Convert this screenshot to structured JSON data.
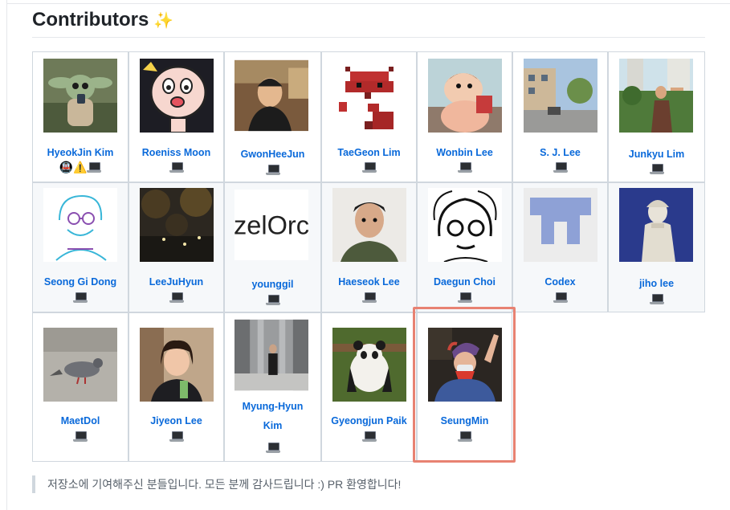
{
  "section": {
    "title": "Contributors",
    "title_icon": "sparkles-icon",
    "note": "저장소에 기여해주신 분들입니다. 모든 분께 감사드립니다 :) PR 환영합니다!"
  },
  "contributors": [
    {
      "name": "HyeokJin Kim",
      "badges": [
        "🚇",
        "⚠️"
      ],
      "laptop": true
    },
    {
      "name": "Roeniss Moon",
      "badges": [],
      "laptop": true
    },
    {
      "name": "GwonHeeJun",
      "badges": [],
      "laptop": true
    },
    {
      "name": "TaeGeon Lim",
      "badges": [],
      "laptop": true
    },
    {
      "name": "Wonbin Lee",
      "badges": [],
      "laptop": true
    },
    {
      "name": "S. J. Lee",
      "badges": [],
      "laptop": true
    },
    {
      "name": "Junkyu Lim",
      "badges": [],
      "laptop": true
    },
    {
      "name": "Seong Gi Dong",
      "badges": [],
      "laptop": true
    },
    {
      "name": "LeeJuHyun",
      "badges": [],
      "laptop": true
    },
    {
      "name": "younggil",
      "badges": [],
      "laptop": true,
      "avatar_text": "zelOrc"
    },
    {
      "name": "Haeseok Lee",
      "badges": [],
      "laptop": true
    },
    {
      "name": "Daegun Choi",
      "badges": [],
      "laptop": true
    },
    {
      "name": "Codex",
      "badges": [],
      "laptop": true
    },
    {
      "name": "jiho lee",
      "badges": [],
      "laptop": true
    },
    {
      "name": "MaetDol",
      "badges": [],
      "laptop": true
    },
    {
      "name": "Jiyeon Lee",
      "badges": [],
      "laptop": true
    },
    {
      "name": "Myung-Hyun Kim",
      "badges": [],
      "laptop": true
    },
    {
      "name": "Gyeongjun Paik",
      "badges": [],
      "laptop": true
    },
    {
      "name": "SeungMin",
      "badges": [],
      "laptop": true,
      "highlighted": true
    }
  ],
  "colors": {
    "link": "#0969da",
    "highlight": "#e88272",
    "border": "#d0d7de"
  }
}
